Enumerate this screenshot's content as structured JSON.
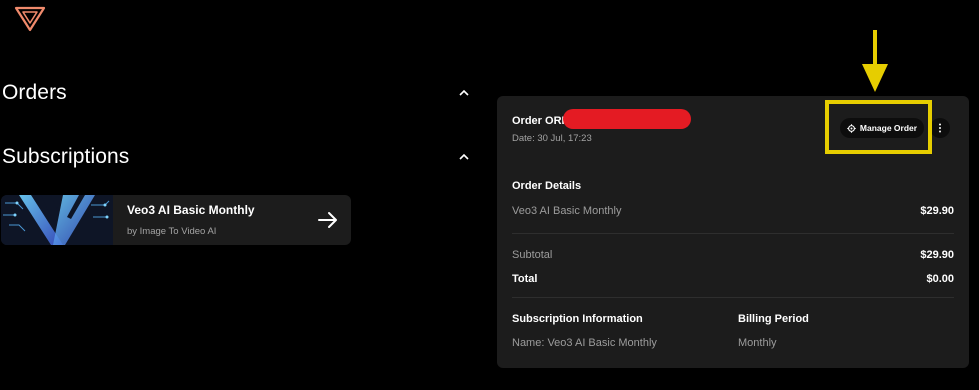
{
  "sections": {
    "orders_title": "Orders",
    "subscriptions_title": "Subscriptions"
  },
  "subscription_card": {
    "name": "Veo3 AI Basic Monthly",
    "by": "by Image To Video AI"
  },
  "order": {
    "title": "Order ORI",
    "date": "Date: 30 Jul, 17:23",
    "manage_label": "Manage Order",
    "details_heading": "Order Details",
    "item_name": "Veo3 AI Basic Monthly",
    "item_price": "$29.90",
    "subtotal_label": "Subtotal",
    "subtotal_value": "$29.90",
    "total_label": "Total",
    "total_value": "$0.00",
    "sub_info_heading": "Subscription Information",
    "billing_heading": "Billing Period",
    "sub_name": "Name: Veo3 AI Basic Monthly",
    "billing_value": "Monthly"
  },
  "colors": {
    "annotation": "#e6cd00",
    "redaction": "#e41b23",
    "panel": "#1c1c1c",
    "logo": "#f08a6c"
  }
}
